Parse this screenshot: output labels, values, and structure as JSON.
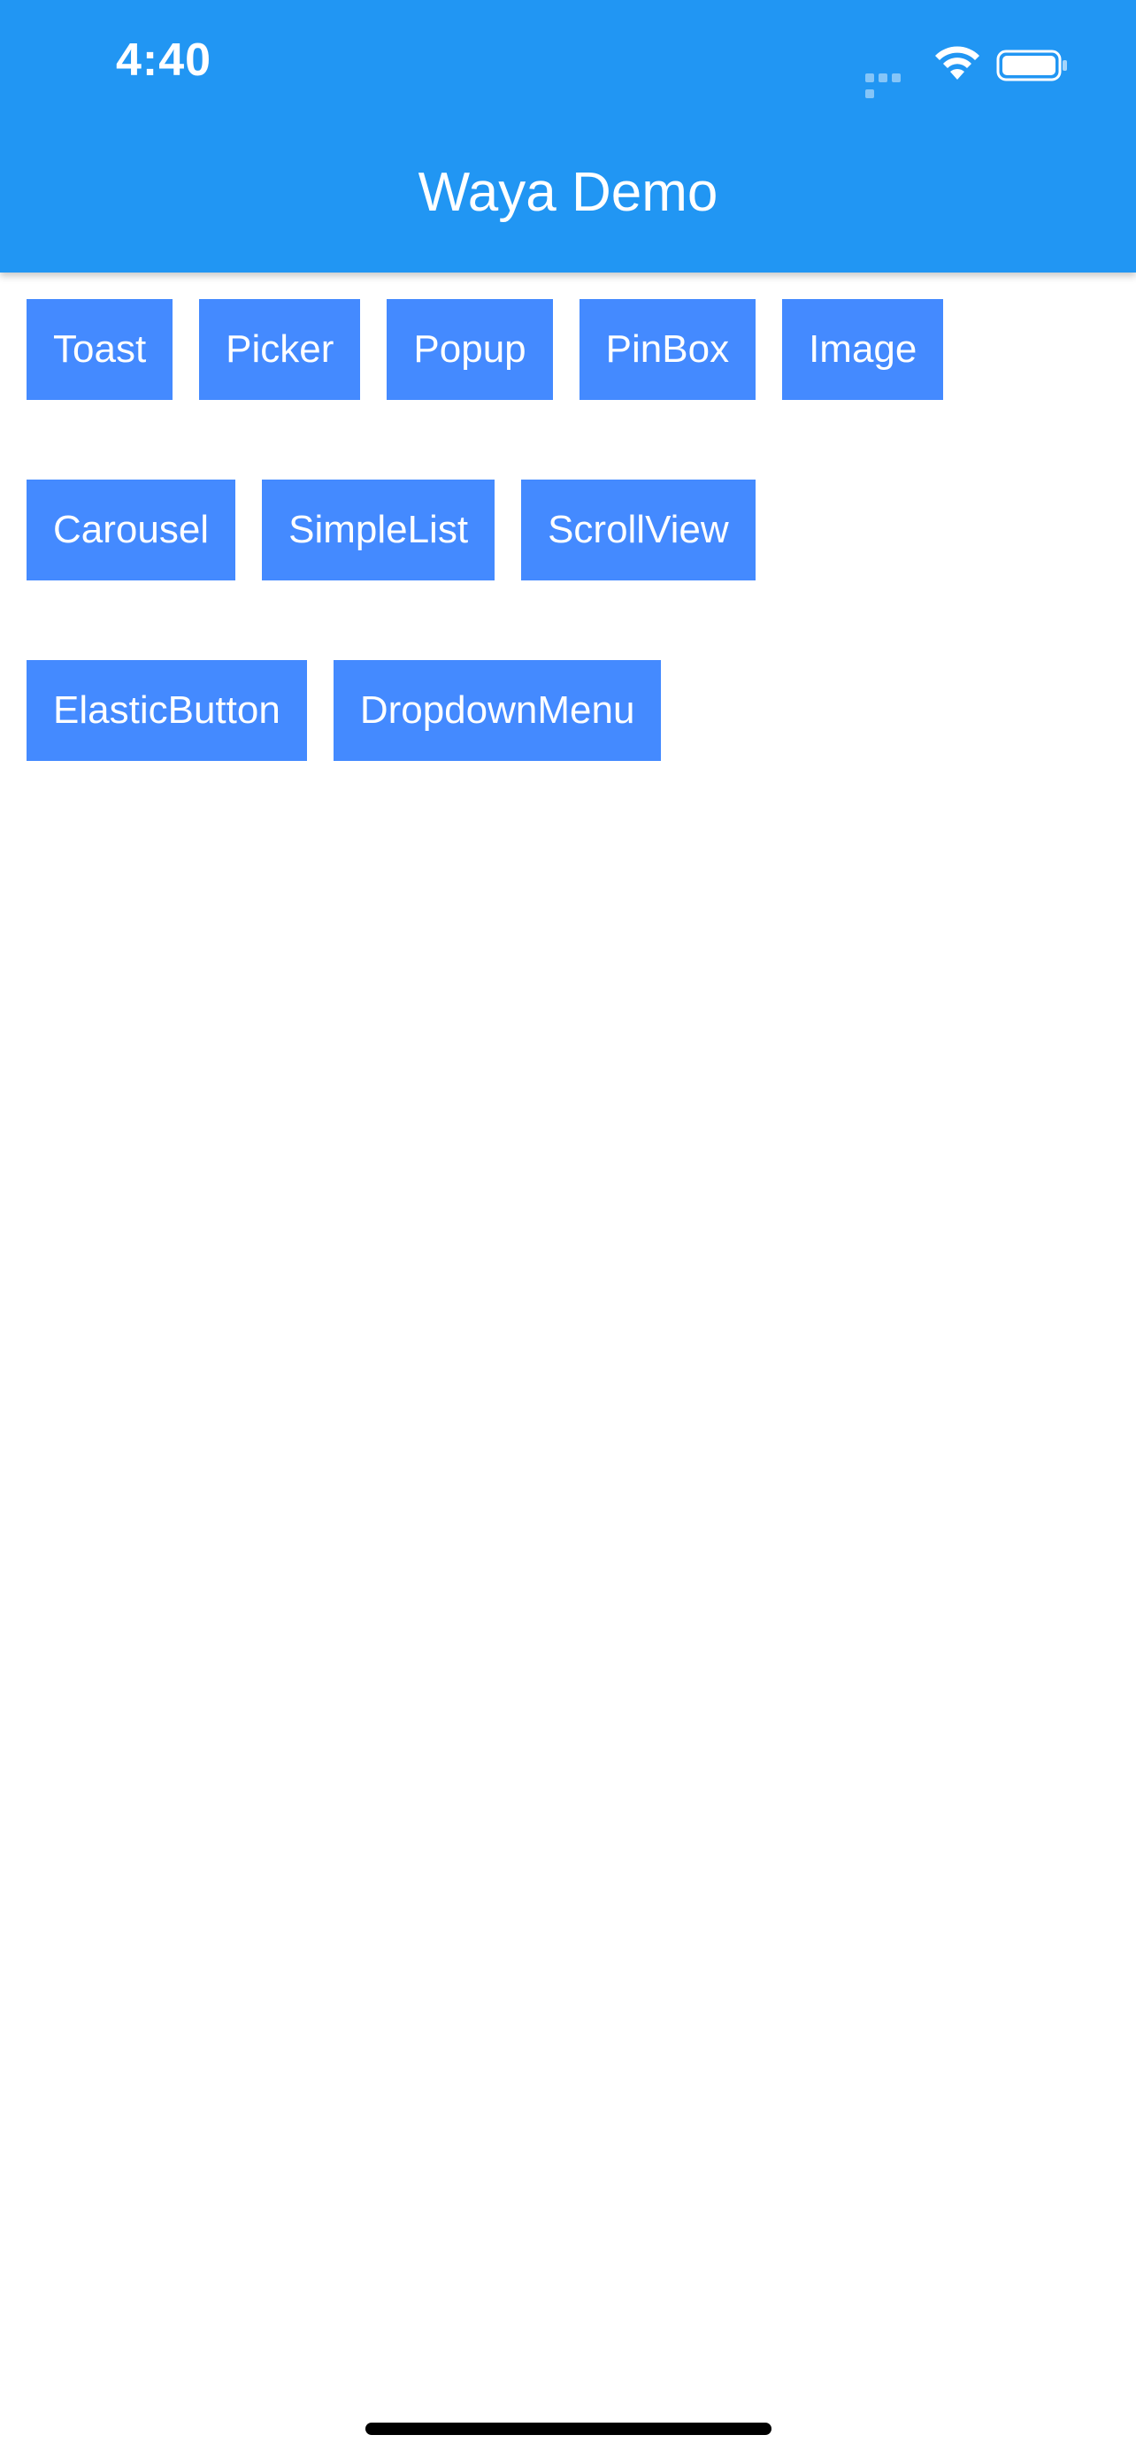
{
  "status_bar": {
    "time": "4:40"
  },
  "app_bar": {
    "title": "Waya Demo",
    "background_color": "#2196f3"
  },
  "buttons": {
    "color": "#448aff",
    "rows": [
      [
        {
          "label": "Toast"
        },
        {
          "label": "Picker"
        },
        {
          "label": "Popup"
        },
        {
          "label": "PinBox"
        },
        {
          "label": "Image"
        }
      ],
      [
        {
          "label": "Carousel"
        },
        {
          "label": "SimpleList"
        },
        {
          "label": "ScrollView"
        }
      ],
      [
        {
          "label": "ElasticButton"
        },
        {
          "label": "DropdownMenu"
        }
      ]
    ]
  },
  "icons": {
    "signal": "cellular-signal-icon",
    "wifi": "wifi-icon",
    "battery": "battery-icon"
  }
}
